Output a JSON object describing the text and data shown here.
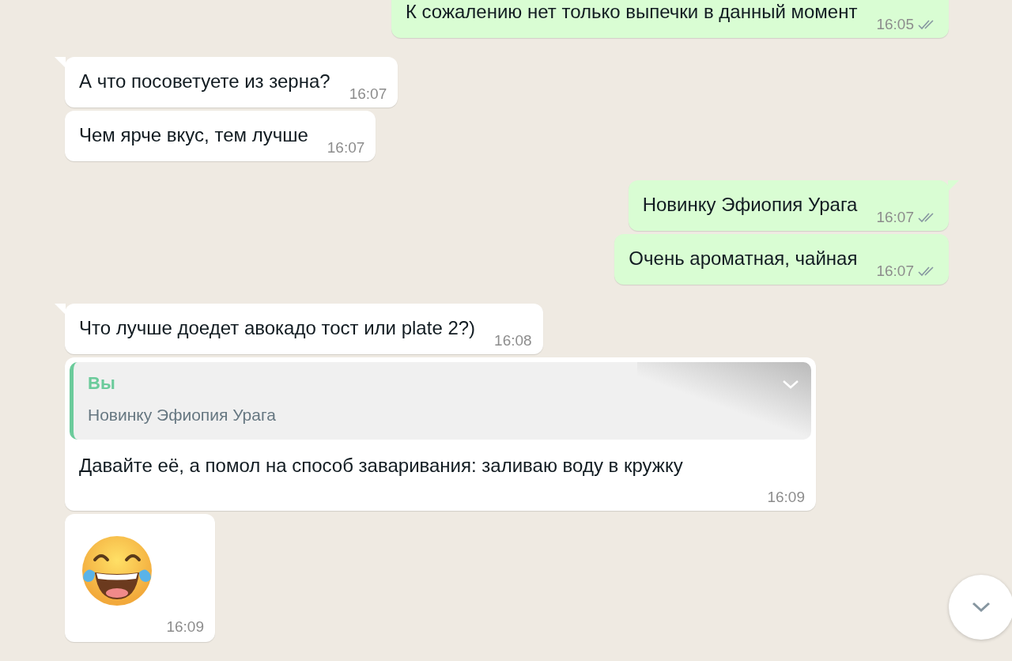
{
  "messages": [
    {
      "kind": "text",
      "outgoing": true,
      "tail": false,
      "text": "К сожалению нет только выпечки в данный момент",
      "time": "16:05",
      "read": false
    },
    {
      "kind": "text",
      "outgoing": false,
      "tail": true,
      "text": "А что посоветуете из зерна?",
      "time": "16:07"
    },
    {
      "kind": "text",
      "outgoing": false,
      "tail": false,
      "text": "Чем ярче вкус, тем лучше",
      "time": "16:07"
    },
    {
      "kind": "text",
      "outgoing": true,
      "tail": true,
      "text": "Новинку Эфиопия Урага",
      "time": "16:07",
      "read": false
    },
    {
      "kind": "text",
      "outgoing": true,
      "tail": false,
      "text": "Очень ароматная, чайная",
      "time": "16:07",
      "read": false
    },
    {
      "kind": "text",
      "outgoing": false,
      "tail": true,
      "text": "Что лучше доедет авокадо тост или plate 2?)",
      "time": "16:08"
    },
    {
      "kind": "reply",
      "outgoing": false,
      "tail": false,
      "quote_author": "Вы",
      "quote_text": "Новинку Эфиопия Урага",
      "text": "Давайте её, а помол на способ заваривания: заливаю воду в кружку",
      "time": "16:09"
    },
    {
      "kind": "emoji",
      "outgoing": false,
      "tail": false,
      "time": "16:09"
    }
  ]
}
